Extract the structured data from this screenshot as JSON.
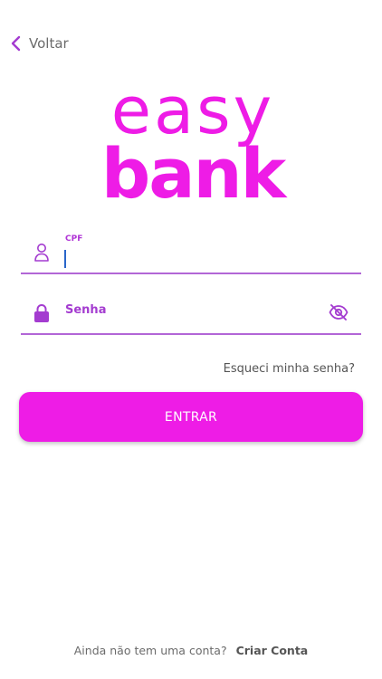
{
  "nav": {
    "back_label": "Voltar"
  },
  "logo": {
    "line1": "easy",
    "line2": "bank"
  },
  "cpf": {
    "label": "CPF",
    "value": ""
  },
  "password": {
    "placeholder": "Senha"
  },
  "forgot": "Esqueci minha senha?",
  "submit_label": "ENTRAR",
  "footer": {
    "text": "Ainda não tem uma conta?",
    "link": "Criar Conta"
  },
  "colors": {
    "brand": "#ee1ce6",
    "accent": "#b034d6",
    "underline": "#b266d6",
    "caret": "#2a66c9"
  },
  "icons": {
    "back": "chevron-left-icon",
    "cpf": "person-icon",
    "password": "lock-icon",
    "visibility": "eye-off-icon"
  }
}
